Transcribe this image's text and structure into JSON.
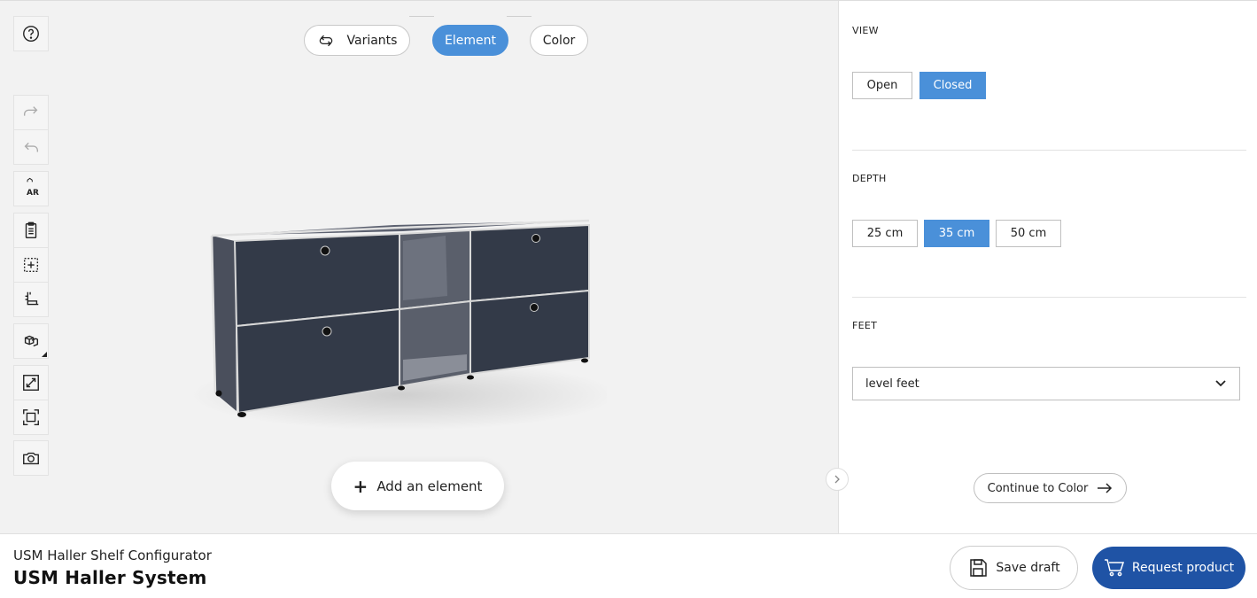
{
  "stepper": {
    "steps": [
      {
        "label": "Variants",
        "icon": "cycle-icon",
        "active": false
      },
      {
        "label": "Element",
        "active": true
      },
      {
        "label": "Color",
        "active": false
      }
    ]
  },
  "toolbar": {
    "tools": [
      "help-icon",
      "redo-icon",
      "undo-icon",
      "ar-icon",
      "clipboard-icon",
      "add-box-icon",
      "measure-icon",
      "cubes-icon",
      "expand-icon",
      "frame-icon",
      "camera-icon"
    ],
    "ar_label": "AR"
  },
  "viewport": {
    "add_element_label": "Add an element",
    "product_color": "#333a48"
  },
  "panel": {
    "view": {
      "label": "VIEW",
      "options": [
        "Open",
        "Closed"
      ],
      "selected": "Closed"
    },
    "depth": {
      "label": "DEPTH",
      "options": [
        "25 cm",
        "35 cm",
        "50 cm"
      ],
      "selected": "35 cm"
    },
    "feet": {
      "label": "FEET",
      "value": "level feet"
    },
    "continue_label": "Continue to Color"
  },
  "footer": {
    "subtitle": "USM Haller Shelf Configurator",
    "title": "USM Haller System",
    "save_label": "Save draft",
    "request_label": "Request product"
  },
  "colors": {
    "accent": "#4a90d9",
    "primary_button": "#1f53a5"
  }
}
